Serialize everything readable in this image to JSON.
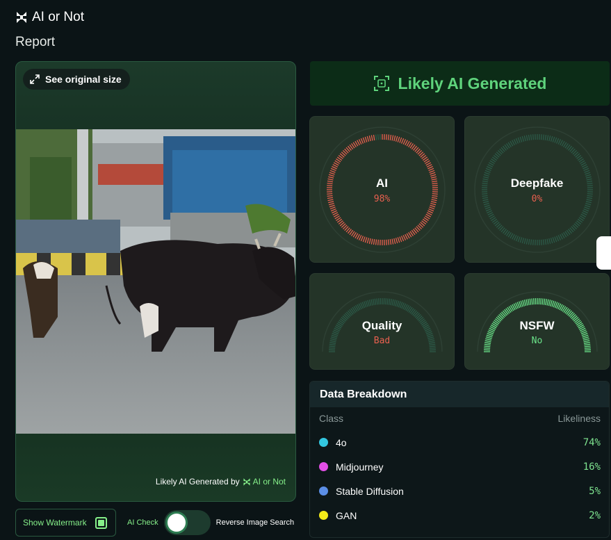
{
  "brand": {
    "name": "AI or Not"
  },
  "page": {
    "title": "Report"
  },
  "image_panel": {
    "see_original_label": "See original size",
    "credit_prefix": "Likely AI Generated by",
    "credit_brand": "AI or Not"
  },
  "controls": {
    "show_watermark_label": "Show Watermark",
    "ai_check_label": "AI Check",
    "reverse_search_label": "Reverse Image Search"
  },
  "verdict": {
    "text": "Likely AI Generated",
    "color": "#5fd37c"
  },
  "metrics": {
    "ai": {
      "label": "AI",
      "value": "98%",
      "fraction": 0.98,
      "color": "#e8604f"
    },
    "deepfake": {
      "label": "Deepfake",
      "value": "0%",
      "fraction": 0.0,
      "color": "#e8604f"
    },
    "quality": {
      "label": "Quality",
      "value": "Bad",
      "color": "#e8604f"
    },
    "nsfw": {
      "label": "NSFW",
      "value": "No",
      "color": "#6be48a"
    }
  },
  "breakdown": {
    "title": "Data Breakdown",
    "col_class": "Class",
    "col_likeliness": "Likeliness",
    "rows": [
      {
        "name": "4o",
        "value": "74%",
        "color": "#33c7e0"
      },
      {
        "name": "Midjourney",
        "value": "16%",
        "color": "#e24fe6"
      },
      {
        "name": "Stable Diffusion",
        "value": "5%",
        "color": "#5b8ee6"
      },
      {
        "name": "GAN",
        "value": "2%",
        "color": "#f3ea19"
      }
    ]
  }
}
